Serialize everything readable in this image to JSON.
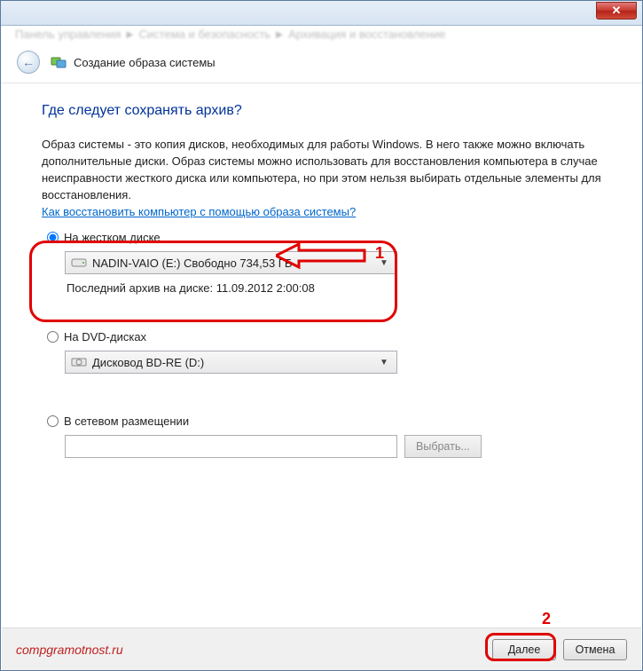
{
  "titlebar": {
    "close_symbol": "✕"
  },
  "breadcrumb": "Панель управления  ►  Система и безопасность  ►  Архивация и восстановление",
  "header": {
    "title": "Создание образа системы"
  },
  "main": {
    "heading": "Где следует сохранять архив?",
    "description": "Образ системы - это копия дисков, необходимых для работы Windows. В него также можно включать дополнительные диски. Образ системы можно использовать для восстановления компьютера в случае неисправности жесткого диска или компьютера, но при этом нельзя выбирать отдельные элементы для восстановления.",
    "help_link": "Как восстановить компьютер с помощью образа системы?"
  },
  "options": {
    "hdd": {
      "label": "На жестком диске",
      "selected": true,
      "combo": "NADIN-VAIO (E:)  Свободно 734,53 ГБ",
      "last_backup": "Последний архив на диске: 11.09.2012 2:00:08"
    },
    "dvd": {
      "label": "На DVD-дисках",
      "selected": false,
      "combo": "Дисковод BD-RE (D:)"
    },
    "network": {
      "label": "В сетевом размещении",
      "selected": false,
      "path": "",
      "browse_label": "Выбрать..."
    }
  },
  "footer": {
    "watermark": "compgramotnost.ru",
    "next": "Далее",
    "cancel": "Отмена"
  },
  "annotations": {
    "n1": "1",
    "n2": "2"
  }
}
